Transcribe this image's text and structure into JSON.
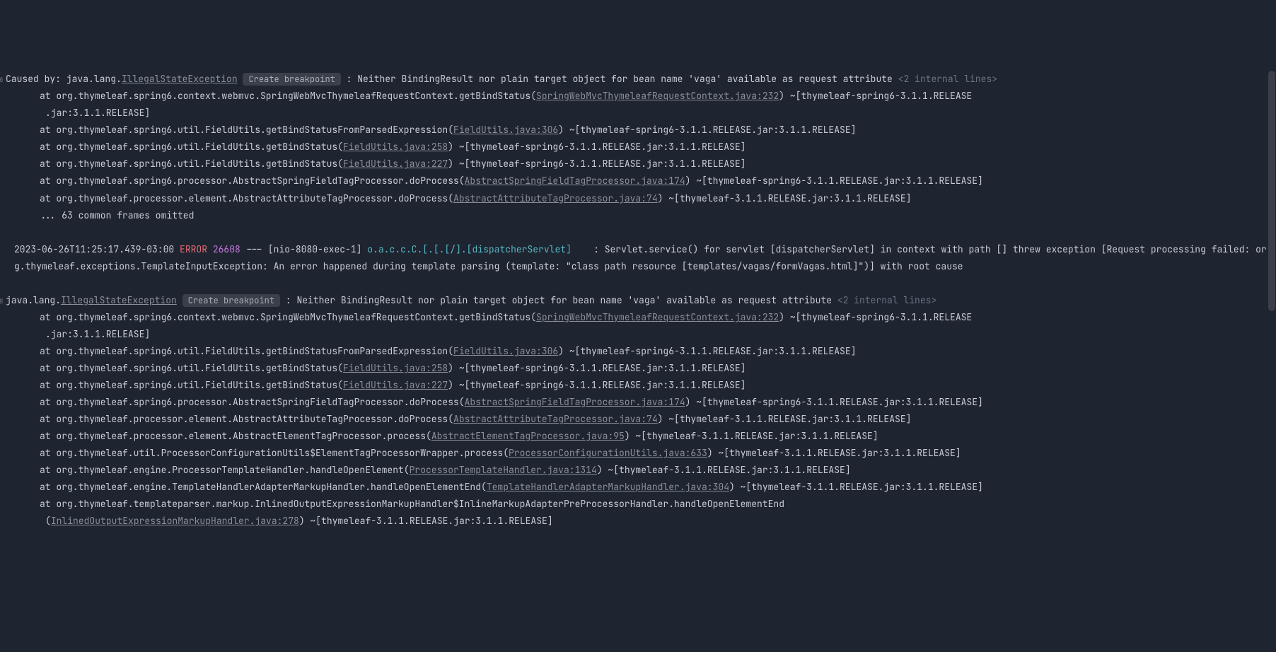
{
  "exception1": {
    "prefix": "Caused by: java.lang.",
    "type": "IllegalStateException",
    "breakpoint": "Create breakpoint",
    "sep": " : ",
    "message": "Neither BindingResult nor plain target object for bean name 'vaga' available as request attribute ",
    "internal": "<2 internal lines>"
  },
  "stack1": [
    {
      "pre": "at org.thymeleaf.spring6.context.webmvc.SpringWebMvcThymeleafRequestContext.getBindStatus(",
      "link": "SpringWebMvcThymeleafRequestContext.java:232",
      "post": ") ~[thymeleaf-spring6-3.1.1.RELEASE",
      "cont": ".jar:3.1.1.RELEASE]"
    },
    {
      "pre": "at org.thymeleaf.spring6.util.FieldUtils.getBindStatusFromParsedExpression(",
      "link": "FieldUtils.java:306",
      "post": ") ~[thymeleaf-spring6-3.1.1.RELEASE.jar:3.1.1.RELEASE]"
    },
    {
      "pre": "at org.thymeleaf.spring6.util.FieldUtils.getBindStatus(",
      "link": "FieldUtils.java:258",
      "post": ") ~[thymeleaf-spring6-3.1.1.RELEASE.jar:3.1.1.RELEASE]"
    },
    {
      "pre": "at org.thymeleaf.spring6.util.FieldUtils.getBindStatus(",
      "link": "FieldUtils.java:227",
      "post": ") ~[thymeleaf-spring6-3.1.1.RELEASE.jar:3.1.1.RELEASE]"
    },
    {
      "pre": "at org.thymeleaf.spring6.processor.AbstractSpringFieldTagProcessor.doProcess(",
      "link": "AbstractSpringFieldTagProcessor.java:174",
      "post": ") ~[thymeleaf-spring6-3.1.1.RELEASE.jar:3.1.1.RELEASE]"
    },
    {
      "pre": "at org.thymeleaf.processor.element.AbstractAttributeTagProcessor.doProcess(",
      "link": "AbstractAttributeTagProcessor.java:74",
      "post": ") ~[thymeleaf-3.1.1.RELEASE.jar:3.1.1.RELEASE]"
    }
  ],
  "omitted1": "... 63 common frames omitted",
  "logline": {
    "ts": "2023-06-26T11:25:17.439-03:00 ",
    "level": "ERROR",
    "pid": " 26608",
    "sep": " --- ",
    "thread": "[nio-8080-exec-1] ",
    "logger": "o.a.c.c.C.[.[.[/].[dispatcherServlet]   ",
    "colon": " : ",
    "msg1": "Servlet.service() for servlet [dispatcherServlet] in context with path [] threw exception [Request processing failed: org.thymeleaf.exceptions.TemplateInputException: An error happened during template parsing (template: \"class path resource [templates/vagas/formVagas.html]\")] with root cause"
  },
  "exception2": {
    "prefix": "java.lang.",
    "type": "IllegalStateException",
    "breakpoint": "Create breakpoint",
    "sep": " : ",
    "message": "Neither BindingResult nor plain target object for bean name 'vaga' available as request attribute ",
    "internal": "<2 internal lines>"
  },
  "stack2": [
    {
      "pre": "at org.thymeleaf.spring6.context.webmvc.SpringWebMvcThymeleafRequestContext.getBindStatus(",
      "link": "SpringWebMvcThymeleafRequestContext.java:232",
      "post": ") ~[thymeleaf-spring6-3.1.1.RELEASE",
      "cont": ".jar:3.1.1.RELEASE]"
    },
    {
      "pre": "at org.thymeleaf.spring6.util.FieldUtils.getBindStatusFromParsedExpression(",
      "link": "FieldUtils.java:306",
      "post": ") ~[thymeleaf-spring6-3.1.1.RELEASE.jar:3.1.1.RELEASE]"
    },
    {
      "pre": "at org.thymeleaf.spring6.util.FieldUtils.getBindStatus(",
      "link": "FieldUtils.java:258",
      "post": ") ~[thymeleaf-spring6-3.1.1.RELEASE.jar:3.1.1.RELEASE]"
    },
    {
      "pre": "at org.thymeleaf.spring6.util.FieldUtils.getBindStatus(",
      "link": "FieldUtils.java:227",
      "post": ") ~[thymeleaf-spring6-3.1.1.RELEASE.jar:3.1.1.RELEASE]"
    },
    {
      "pre": "at org.thymeleaf.spring6.processor.AbstractSpringFieldTagProcessor.doProcess(",
      "link": "AbstractSpringFieldTagProcessor.java:174",
      "post": ") ~[thymeleaf-spring6-3.1.1.RELEASE.jar:3.1.1.RELEASE]"
    },
    {
      "pre": "at org.thymeleaf.processor.element.AbstractAttributeTagProcessor.doProcess(",
      "link": "AbstractAttributeTagProcessor.java:74",
      "post": ") ~[thymeleaf-3.1.1.RELEASE.jar:3.1.1.RELEASE]"
    },
    {
      "pre": "at org.thymeleaf.processor.element.AbstractElementTagProcessor.process(",
      "link": "AbstractElementTagProcessor.java:95",
      "post": ") ~[thymeleaf-3.1.1.RELEASE.jar:3.1.1.RELEASE]"
    },
    {
      "pre": "at org.thymeleaf.util.ProcessorConfigurationUtils$ElementTagProcessorWrapper.process(",
      "link": "ProcessorConfigurationUtils.java:633",
      "post": ") ~[thymeleaf-3.1.1.RELEASE.jar:3.1.1.RELEASE]"
    },
    {
      "pre": "at org.thymeleaf.engine.ProcessorTemplateHandler.handleOpenElement(",
      "link": "ProcessorTemplateHandler.java:1314",
      "post": ") ~[thymeleaf-3.1.1.RELEASE.jar:3.1.1.RELEASE]"
    },
    {
      "pre": "at org.thymeleaf.engine.TemplateHandlerAdapterMarkupHandler.handleOpenElementEnd(",
      "link": "TemplateHandlerAdapterMarkupHandler.java:304",
      "post": ") ~[thymeleaf-3.1.1.RELEASE.jar:3.1.1.RELEASE]"
    },
    {
      "pre": "at org.thymeleaf.templateparser.markup.InlinedOutputExpressionMarkupHandler$InlineMarkupAdapterPreProcessorHandler.handleOpenElementEnd",
      "link": "",
      "post": "",
      "cont2pre": "(",
      "cont2link": "InlinedOutputExpressionMarkupHandler.java:278",
      "cont2post": ") ~[thymeleaf-3.1.1.RELEASE.jar:3.1.1.RELEASE]"
    }
  ],
  "expand_icon": "⊞"
}
